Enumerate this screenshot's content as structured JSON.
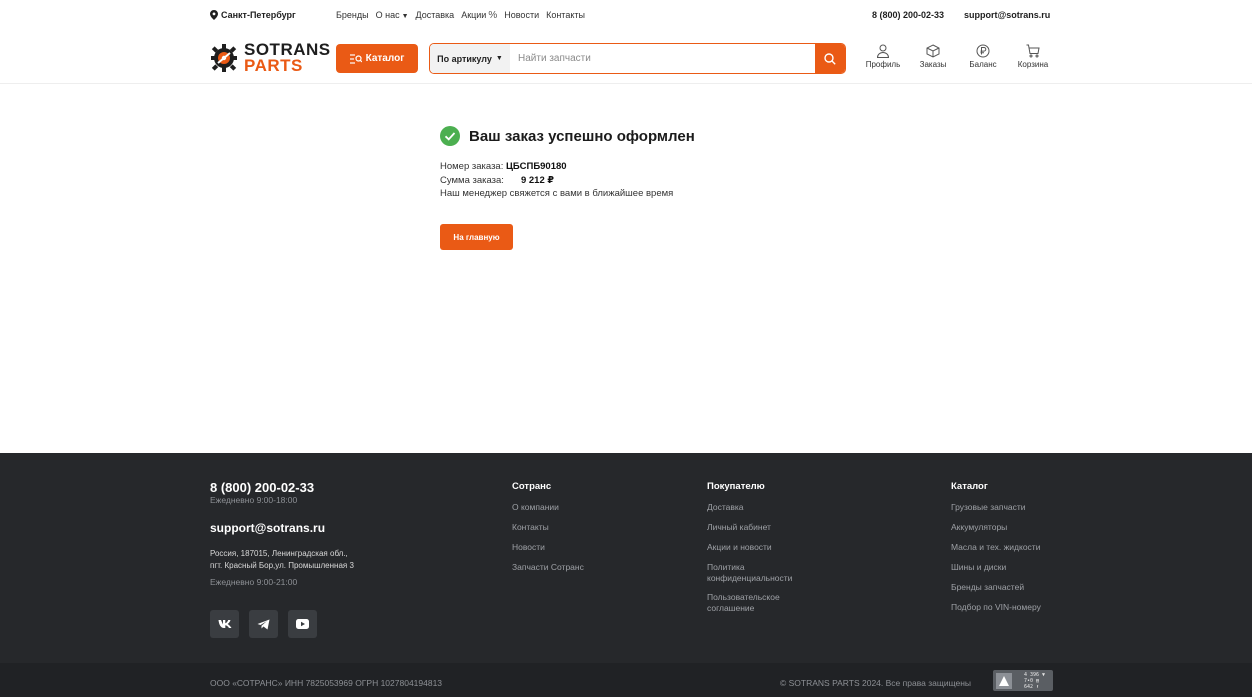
{
  "topbar": {
    "city": "Санкт-Петербург",
    "nav": [
      "Бренды",
      "О нас",
      "Доставка",
      "Акции",
      "Новости",
      "Контакты"
    ],
    "phone": "8 (800) 200-02-33",
    "email": "support@sotrans.ru"
  },
  "header": {
    "logo_line1": "SOTRANS",
    "logo_line2": "PARTS",
    "catalog_label": "Каталог",
    "search_mode": "По артикулу",
    "search_placeholder": "Найти запчасти",
    "icons": [
      {
        "label": "Профиль",
        "icon": "user-icon"
      },
      {
        "label": "Заказы",
        "icon": "box-icon"
      },
      {
        "label": "Баланс",
        "icon": "ruble-icon"
      },
      {
        "label": "Корзина",
        "icon": "cart-icon"
      }
    ]
  },
  "main": {
    "title": "Ваш заказ успешно оформлен",
    "order_number_label": "Номер заказа:",
    "order_number": "ЦБСПБ90180",
    "order_sum_label": "Сумма заказа:",
    "order_sum": "9 212 ₽",
    "message": "Наш менеджер свяжется с вами в ближайшее время",
    "home_button": "На главную"
  },
  "footer": {
    "phone": "8 (800) 200-02-33",
    "phone_hours": "Ежедневно 9:00-18:00",
    "email": "support@sotrans.ru",
    "address_line1": "Россия, 187015, Ленинградская обл.,",
    "address_line2": "пгт. Красный Бор,ул. Промышленная 3",
    "address_hours": "Ежедневно 9:00-21:00",
    "socials": [
      "vk-icon",
      "telegram-icon",
      "youtube-icon"
    ],
    "col_company": {
      "title": "Сотранс",
      "links": [
        "О компании",
        "Контакты",
        "Новости",
        "Запчасти Сотранс"
      ]
    },
    "col_buyer": {
      "title": "Покупателю",
      "links": [
        "Доставка",
        "Личный кабинет",
        "Акции и новости",
        "Политика конфиденциальности",
        "Пользовательское соглашение"
      ]
    },
    "col_catalog": {
      "title": "Каталог",
      "links": [
        "Грузовые запчасти",
        "Аккумуляторы",
        "Масла и тех. жидкости",
        "Шины и диски",
        "Бренды запчастей",
        "Подбор по VIN-номеру"
      ]
    },
    "legal": "ООО «СОТРАНС»   ИНН 7825053969   ОГРН 1027804194813",
    "copyright": "© SOTRANS PARTS 2024. Все права защищены",
    "counter_lines": [
      "4 396 ▼",
      "7•0 ▤",
      "642 ⬆"
    ]
  },
  "colors": {
    "accent": "#ea5a15",
    "footer_bg": "#26282b",
    "footer_bottom_bg": "#202225",
    "success_green": "#4caf50"
  }
}
